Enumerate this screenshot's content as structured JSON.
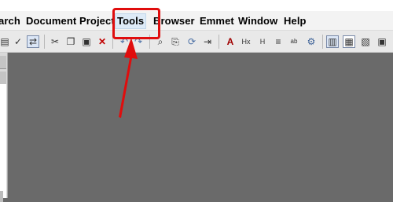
{
  "menu": {
    "search": "arch",
    "document": "Document",
    "project": "Project",
    "tools": "Tools",
    "browser": "Browser",
    "emmet": "Emmet",
    "window": "Window",
    "help": "Help"
  },
  "toolbar": {
    "icons": [
      "print-icon",
      "spellcheck-icon",
      "preview-icon",
      "cut-icon",
      "copy-icon",
      "paste-icon",
      "delete-icon",
      "undo-icon",
      "redo-icon",
      "find-icon",
      "replace-icon",
      "refresh-icon",
      "indent-icon",
      "font-color-icon",
      "hex-icon",
      "header-icon",
      "bold-icon",
      "abc-icon",
      "settings-icon",
      "panel-icon",
      "layout-icon",
      "browser-icon",
      "window-icon"
    ]
  },
  "colors": {
    "highlight": "#e00d0d",
    "workspace": "#6a6a6a",
    "menubar": "#f3f3f3"
  }
}
